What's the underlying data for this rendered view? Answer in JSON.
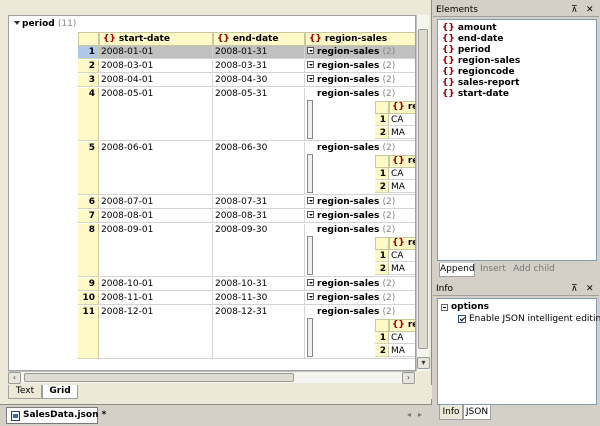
{
  "editor": {
    "root_label": "period",
    "root_count": "(11)",
    "columns": [
      "start-date",
      "end-date",
      "region-sales"
    ],
    "rows": [
      {
        "n": "1",
        "start": "2008-01-01",
        "end": "2008-01-31",
        "label": "region-sales",
        "count": "(2)",
        "expanded": false
      },
      {
        "n": "2",
        "start": "2008-03-01",
        "end": "2008-03-31",
        "label": "region-sales",
        "count": "(2)",
        "expanded": false
      },
      {
        "n": "3",
        "start": "2008-04-01",
        "end": "2008-04-30",
        "label": "region-sales",
        "count": "(2)",
        "expanded": false
      },
      {
        "n": "4",
        "start": "2008-05-01",
        "end": "2008-05-31",
        "label": "region-sales",
        "count": "(2)",
        "expanded": true
      },
      {
        "n": "5",
        "start": "2008-06-01",
        "end": "2008-06-30",
        "label": "region-sales",
        "count": "(2)",
        "expanded": true
      },
      {
        "n": "6",
        "start": "2008-07-01",
        "end": "2008-07-31",
        "label": "region-sales",
        "count": "(2)",
        "expanded": false
      },
      {
        "n": "7",
        "start": "2008-08-01",
        "end": "2008-08-31",
        "label": "region-sales",
        "count": "(2)",
        "expanded": false
      },
      {
        "n": "8",
        "start": "2008-09-01",
        "end": "2008-09-30",
        "label": "region-sales",
        "count": "(2)",
        "expanded": true
      },
      {
        "n": "9",
        "start": "2008-10-01",
        "end": "2008-10-31",
        "label": "region-sales",
        "count": "(2)",
        "expanded": false
      },
      {
        "n": "10",
        "start": "2008-11-01",
        "end": "2008-11-30",
        "label": "region-sales",
        "count": "(2)",
        "expanded": false
      },
      {
        "n": "11",
        "start": "2008-12-01",
        "end": "2008-12-31",
        "label": "region-sales",
        "count": "(2)",
        "expanded": true
      }
    ],
    "sub_header": "regio",
    "sub_rows": [
      {
        "n": "1",
        "v": "CA"
      },
      {
        "n": "2",
        "v": "MA"
      }
    ]
  },
  "view_tabs": [
    "Text",
    "Grid"
  ],
  "document_tab": "SalesData.json *",
  "elements_pane": {
    "title": "Elements",
    "pin": "⊼",
    "close": "✕",
    "items": [
      "amount",
      "end-date",
      "period",
      "region-sales",
      "regioncode",
      "sales-report",
      "start-date"
    ],
    "tabs": [
      "Append",
      "Insert",
      "Add child"
    ]
  },
  "info_pane": {
    "title": "Info",
    "pin": "⊼",
    "close": "✕",
    "group": "options",
    "option": "Enable JSON intelligent editing",
    "tabs": [
      "Info",
      "JSON"
    ]
  },
  "icons": {
    "brace": "{}",
    "expand": "expand-arrow-icon"
  }
}
